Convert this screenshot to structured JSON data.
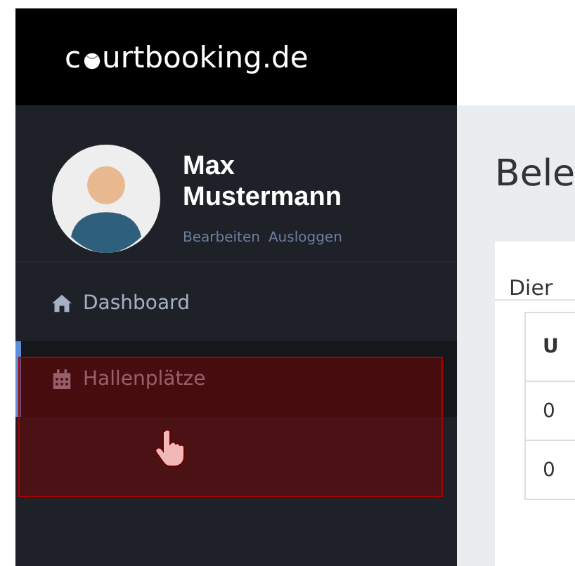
{
  "logo": {
    "prefix": "c",
    "suffix": "urtbooking.de"
  },
  "user": {
    "name": "Max Mustermann",
    "links": [
      "Bearbeiten",
      "Ausloggen"
    ]
  },
  "nav": [
    {
      "label": "Dashboard",
      "kind": "home",
      "selected": false
    },
    {
      "label": "Hallenplätze",
      "kind": "calendar",
      "selected": true
    }
  ],
  "main": {
    "heading": "Bele",
    "card_title": "Dier",
    "table": {
      "header": "U",
      "rows": [
        "0",
        "0"
      ]
    }
  },
  "annotation": {
    "highlight": true
  }
}
